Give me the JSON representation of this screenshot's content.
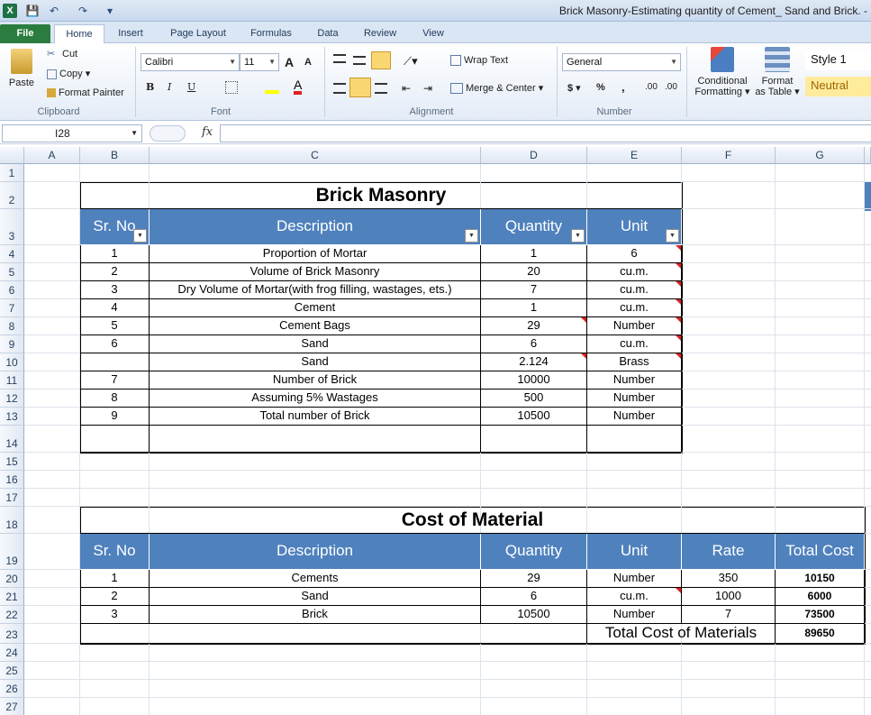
{
  "window": {
    "title": "Brick Masonry-Estimating quantity of Cement_ Sand and Brick. -",
    "app_icon": "X"
  },
  "quick_access": {
    "save_icon": "💾",
    "undo_icon": "↶",
    "redo_icon": "↷",
    "customize_icon": "▾"
  },
  "ribbon_tabs": [
    "File",
    "Home",
    "Insert",
    "Page Layout",
    "Formulas",
    "Data",
    "Review",
    "View"
  ],
  "clipboard": {
    "paste": "Paste",
    "cut": "Cut",
    "copy": "Copy",
    "format_painter": "Format Painter",
    "group": "Clipboard"
  },
  "font": {
    "name": "Calibri",
    "size": "11",
    "group": "Font",
    "bold": "B",
    "italic": "I",
    "underline": "U",
    "grow": "A",
    "shrink": "A"
  },
  "alignment": {
    "wrap": "Wrap Text",
    "merge": "Merge & Center",
    "group": "Alignment"
  },
  "number": {
    "format": "General",
    "currency": "$",
    "percent": "%",
    "comma": ",",
    "inc": ".00",
    "dec": ".00",
    "group": "Number"
  },
  "styles": {
    "conditional_line1": "Conditional",
    "conditional_line2": "Formatting",
    "format_table_line1": "Format",
    "format_table_line2": "as Table",
    "style1": "Style 1",
    "neutral": "Neutral"
  },
  "formula_bar": {
    "name_box": "I28",
    "fx": "fx",
    "content": ""
  },
  "columns": [
    "A",
    "B",
    "C",
    "D",
    "E",
    "F",
    "G"
  ],
  "rows": [
    "1",
    "2",
    "3",
    "4",
    "5",
    "6",
    "7",
    "8",
    "9",
    "10",
    "11",
    "12",
    "13",
    "14",
    "15",
    "16",
    "17",
    "18",
    "19",
    "20",
    "21",
    "22",
    "23",
    "24",
    "25",
    "26",
    "27"
  ],
  "brick_masonry": {
    "title": "Brick Masonry",
    "headers": [
      "Sr. No",
      "Description",
      "Quantity",
      "Unit"
    ],
    "rows": [
      [
        "1",
        "Proportion of Mortar",
        "1",
        "6"
      ],
      [
        "2",
        "Volume of Brick Masonry",
        "20",
        "cu.m."
      ],
      [
        "3",
        "Dry Volume of Mortar(with frog filling, wastages, ets.)",
        "7",
        "cu.m."
      ],
      [
        "4",
        "Cement",
        "1",
        "cu.m."
      ],
      [
        "5",
        "Cement Bags",
        "29",
        "Number"
      ],
      [
        "6",
        "Sand",
        "6",
        "cu.m."
      ],
      [
        "",
        "Sand",
        "2.124",
        "Brass"
      ],
      [
        "7",
        "Number of Brick",
        "10000",
        "Number"
      ],
      [
        "8",
        "Assuming 5% Wastages",
        "500",
        "Number"
      ],
      [
        "9",
        "Total number of Brick",
        "10500",
        "Number"
      ],
      [
        "",
        "",
        "",
        ""
      ]
    ]
  },
  "cost_of_material": {
    "title": "Cost of Material",
    "headers": [
      "Sr. No",
      "Description",
      "Quantity",
      "Unit",
      "Rate",
      "Total Cost"
    ],
    "rows": [
      [
        "1",
        "Cements",
        "29",
        "Number",
        "350",
        "10150"
      ],
      [
        "2",
        "Sand",
        "6",
        "cu.m.",
        "1000",
        "6000"
      ],
      [
        "3",
        "Brick",
        "10500",
        "Number",
        "7",
        "73500"
      ]
    ],
    "total_label": "Total Cost of Materials",
    "total_value": "89650"
  },
  "colors": {
    "header_fill": "#4f81bd",
    "file_tab": "#2a7d3e",
    "neutral_fill": "#ffeb9c"
  }
}
